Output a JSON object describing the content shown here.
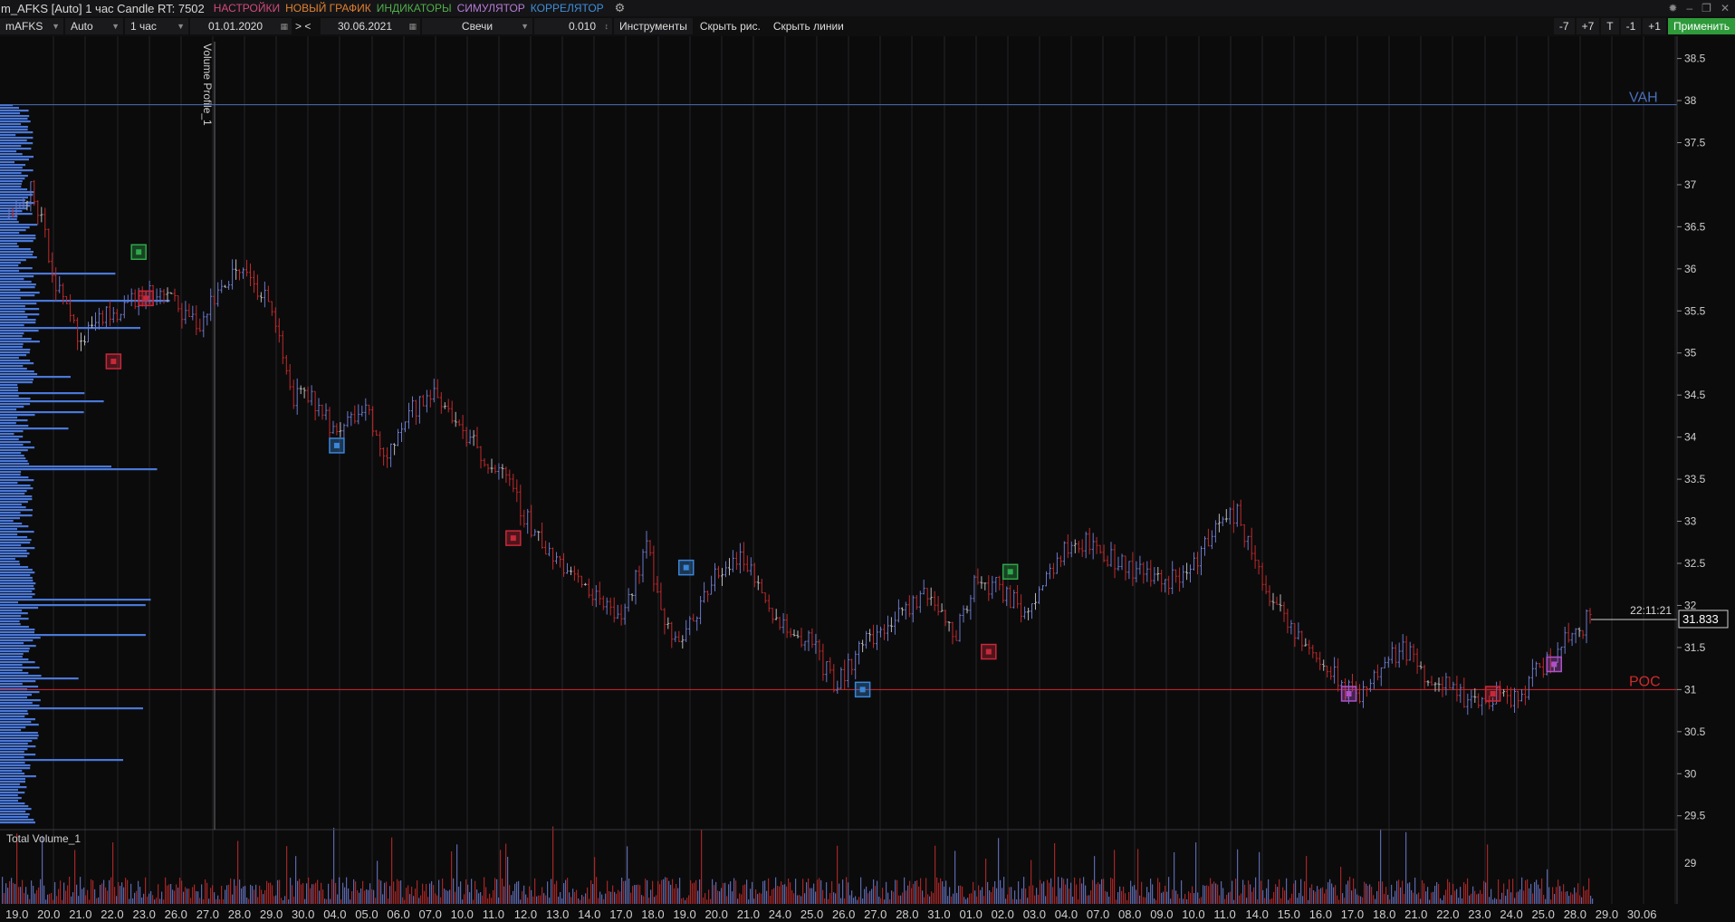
{
  "window": {
    "title": "m_AFKS [Auto] 1 час Candle RT: 7502",
    "menus": [
      {
        "label": "НАСТРОЙКИ",
        "color": "#d24a7a"
      },
      {
        "label": "НОВЫЙ ГРАФИК",
        "color": "#e08030"
      },
      {
        "label": "ИНДИКАТОРЫ",
        "color": "#4fae4a"
      },
      {
        "label": "СИМУЛЯТОР",
        "color": "#b57ad6"
      },
      {
        "label": "КОРРЕЛЯТОР",
        "color": "#3f8ed8"
      }
    ],
    "controls": [
      "✹",
      "–",
      "❐",
      "✕"
    ]
  },
  "toolbar": {
    "symbol": "mAFKS",
    "mode": "Auto",
    "timeframe": "1 час",
    "date_from": "01.01.2020",
    "nav": "> <",
    "date_to": "30.06.2021",
    "chart_type": "Свечи",
    "tick_size": "0.010",
    "instruments": "Инструменты",
    "hide_drawings": "Скрыть рис.",
    "hide_lines": "Скрыть линии",
    "shift_buttons": [
      "-7",
      "+7",
      "T",
      "-1",
      "+1"
    ],
    "apply": "Применить"
  },
  "indicators": {
    "volume_profile": "Volume Profile_1",
    "total_volume": "Total Volume_1",
    "vah_label": "VAH",
    "poc_label": "POC"
  },
  "colors": {
    "bull": "#6a78c8",
    "bear": "#c02a2a",
    "neutral": "#b8b8b8",
    "vah": "#4a6fb8",
    "poc": "#d12a2a",
    "profile": "#4a78d8",
    "price_line": "#cfcfcf"
  },
  "chart_data": {
    "type": "candlestick",
    "ylim": [
      29.4,
      38.7
    ],
    "yticks": [
      29.5,
      30,
      30.5,
      31,
      31.5,
      32,
      32.5,
      33,
      33.5,
      34,
      34.5,
      35,
      35.5,
      36,
      36.5,
      37,
      37.5,
      38,
      38.5
    ],
    "vah": 37.95,
    "poc": 31.0,
    "last_price": "31.833",
    "last_time": "22:11:21",
    "volume_tick": "29",
    "x_labels": [
      "19.0",
      "20.0",
      "21.0",
      "22.0",
      "23.0",
      "26.0",
      "27.0",
      "28.0",
      "29.0",
      "30.0",
      "04.0",
      "05.0",
      "06.0",
      "07.0",
      "10.0",
      "11.0",
      "12.0",
      "13.0",
      "14.0",
      "17.0",
      "18.0",
      "19.0",
      "20.0",
      "21.0",
      "24.0",
      "25.0",
      "26.0",
      "27.0",
      "28.0",
      "31.0",
      "01.0",
      "02.0",
      "03.0",
      "04.0",
      "07.0",
      "08.0",
      "09.0",
      "10.0",
      "11.0",
      "14.0",
      "15.0",
      "16.0",
      "17.0",
      "18.0",
      "21.0",
      "22.0",
      "23.0",
      "24.0",
      "25.0",
      "28.0",
      "29.0",
      "30.06"
    ],
    "price_path": [
      36.6,
      37.0,
      35.8,
      35.1,
      35.4,
      35.6,
      35.7,
      35.6,
      35.3,
      35.8,
      36.0,
      35.6,
      34.5,
      34.4,
      34.0,
      34.4,
      33.8,
      34.3,
      34.5,
      34.2,
      33.8,
      33.5,
      33.0,
      32.6,
      32.3,
      32.1,
      31.9,
      32.7,
      31.6,
      31.8,
      32.4,
      32.6,
      32.1,
      31.7,
      31.6,
      31.0,
      31.5,
      31.7,
      31.9,
      32.2,
      31.6,
      32.3,
      32.2,
      31.9,
      32.4,
      32.8,
      32.7,
      32.5,
      32.4,
      32.3,
      32.4,
      32.9,
      33.1,
      32.4,
      31.8,
      31.5,
      31.2,
      30.9,
      31.2,
      31.5,
      31.2,
      31.0,
      30.8,
      30.9,
      30.9,
      31.3,
      31.6,
      31.85
    ],
    "markers": [
      {
        "x": 36,
        "y": 36.2,
        "color": "#2ea84a"
      },
      {
        "x": 38,
        "y": 35.65,
        "color": "#c8283a"
      },
      {
        "x": 29,
        "y": 34.9,
        "color": "#c8283a"
      },
      {
        "x": 91,
        "y": 33.9,
        "color": "#3a86d8"
      },
      {
        "x": 140,
        "y": 32.8,
        "color": "#c8283a"
      },
      {
        "x": 188,
        "y": 32.45,
        "color": "#3a86d8"
      },
      {
        "x": 237,
        "y": 31.0,
        "color": "#3a86d8"
      },
      {
        "x": 272,
        "y": 31.45,
        "color": "#c8283a"
      },
      {
        "x": 278,
        "y": 32.4,
        "color": "#2ea84a"
      },
      {
        "x": 372,
        "y": 30.95,
        "color": "#b050c8"
      },
      {
        "x": 412,
        "y": 30.95,
        "color": "#c8283a"
      },
      {
        "x": 429,
        "y": 31.3,
        "color": "#b050c8"
      }
    ]
  }
}
